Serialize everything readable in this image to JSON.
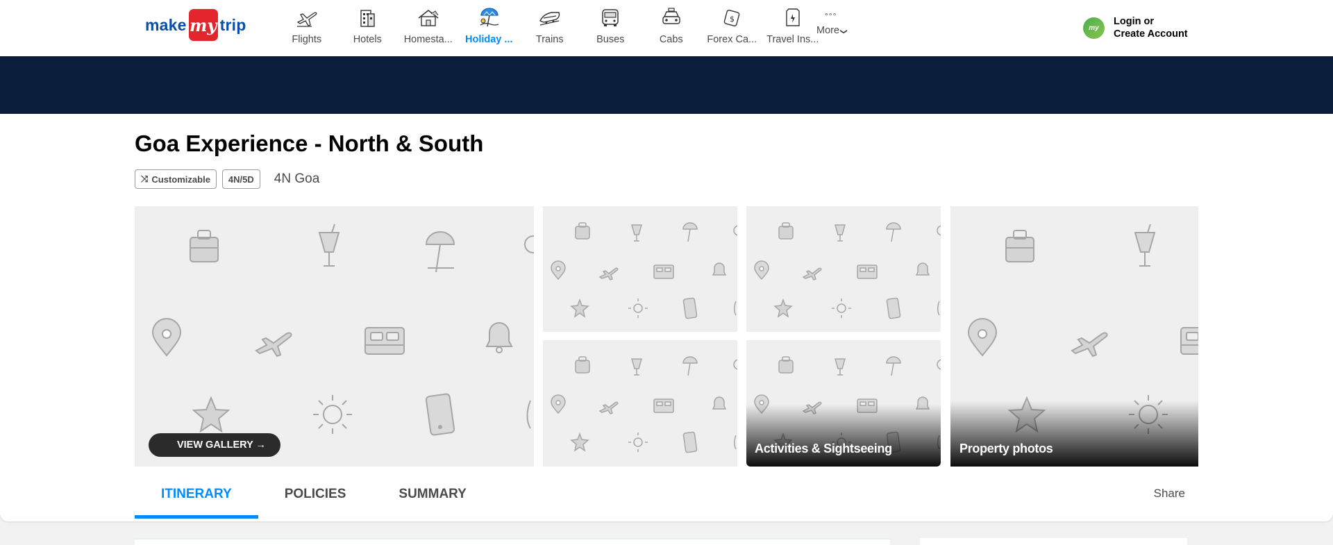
{
  "logo": {
    "part1": "make",
    "part2": "my",
    "part3": "trip"
  },
  "nav": [
    {
      "label": "Flights",
      "icon": "flight-icon",
      "active": false
    },
    {
      "label": "Hotels",
      "icon": "hotel-icon",
      "active": false
    },
    {
      "label": "Homesta...",
      "icon": "homestay-icon",
      "active": false
    },
    {
      "label": "Holiday ...",
      "icon": "holiday-icon",
      "active": true
    },
    {
      "label": "Trains",
      "icon": "train-icon",
      "active": false
    },
    {
      "label": "Buses",
      "icon": "bus-icon",
      "active": false
    },
    {
      "label": "Cabs",
      "icon": "cab-icon",
      "active": false
    },
    {
      "label": "Forex Ca...",
      "icon": "forex-card-icon",
      "active": false
    },
    {
      "label": "Travel Ins...",
      "icon": "travel-insurance-icon",
      "active": false
    }
  ],
  "more": {
    "dots": "°°°",
    "label": "More",
    "chevron": "❯"
  },
  "login": {
    "avatar": "my",
    "line1": "Login or",
    "line2": "Create Account"
  },
  "package": {
    "title": "Goa Experience - North & South",
    "tags": [
      "Customizable",
      "4N/5D"
    ],
    "shuffle_icon": "⤨",
    "subtitle": "4N Goa"
  },
  "gallery": {
    "view_gallery": "VIEW GALLERY →",
    "activities_label": "Activities & Sightseeing",
    "property_label": "Property photos"
  },
  "tabs": [
    {
      "label": "ITINERARY",
      "active": true
    },
    {
      "label": "POLICIES",
      "active": false
    },
    {
      "label": "SUMMARY",
      "active": false
    }
  ],
  "share_label": "Share",
  "colors": {
    "brand_blue": "#008cff",
    "banner": "#0b1f3c",
    "logo_red": "#e3262b"
  }
}
